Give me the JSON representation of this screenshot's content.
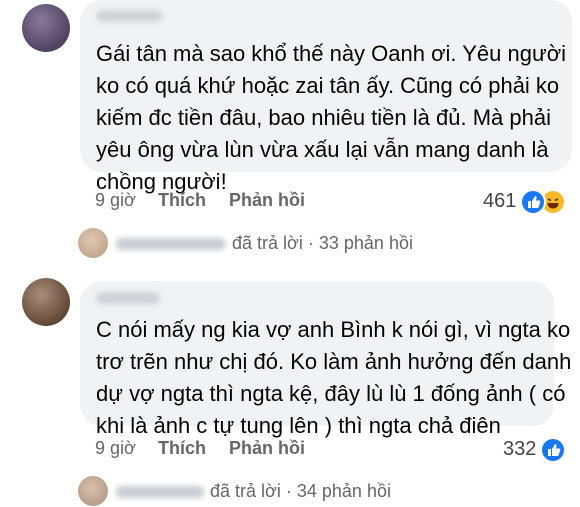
{
  "comments": [
    {
      "lines": [
        "Gái tân mà sao khổ thế này Oanh ơi. Yêu người",
        "ko có quá khứ hoặc zai tân ấy. Cũng có phải ko",
        "kiếm đc tiền đâu, bao nhiêu tiền là đủ. Mà phải",
        "yêu ông vừa lùn vừa xấu lại vẫn mang danh là",
        "chồng người!"
      ],
      "time": "9 giờ",
      "like_label": "Thích",
      "reply_label": "Phản hồi",
      "reaction_count": "461",
      "reactions": [
        "like-icon",
        "haha-icon"
      ],
      "replies": {
        "action_text": "đã trả lời",
        "separator": "·",
        "count_text": "33 phản hồi"
      }
    },
    {
      "lines": [
        "C nói mấy ng kia vợ anh Bình k nói gì, vì ngta ko",
        "trơ trẽn như chị đó. Ko làm ảnh hưởng đến danh",
        "dự vợ ngta thì ngta kệ, đây lù lù 1 đống ảnh ( có",
        "khi là ảnh c tự tung lên ) thì ngta chả điên"
      ],
      "time": "9 giờ",
      "like_label": "Thích",
      "reply_label": "Phản hồi",
      "reaction_count": "332",
      "reactions": [
        "like-icon"
      ],
      "replies": {
        "action_text": "đã trả lời",
        "separator": "·",
        "count_text": "34 phản hồi"
      }
    }
  ],
  "colors": {
    "bubble": "#f0f2f5",
    "secondary_text": "#65676b",
    "like_blue": "#1877f2",
    "haha_yellow": "#f7b928"
  }
}
